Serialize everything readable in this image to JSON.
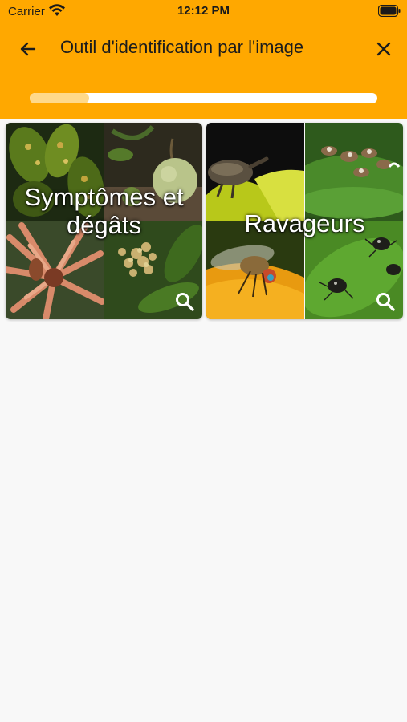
{
  "status_bar": {
    "carrier": "Carrier",
    "time": "12:12 PM"
  },
  "header": {
    "title": "Outil d'identification par l'image",
    "progress": 0.17,
    "back_icon": "arrow-left-icon",
    "close_icon": "close-icon"
  },
  "cards": [
    {
      "label": "Symptômes et dégâts",
      "icon": "search-icon"
    },
    {
      "label": "Ravageurs",
      "icon": "search-icon"
    }
  ],
  "colors": {
    "header": "#ffa800",
    "progress_fill": "#ffd98a",
    "background": "#f8f8f8"
  }
}
